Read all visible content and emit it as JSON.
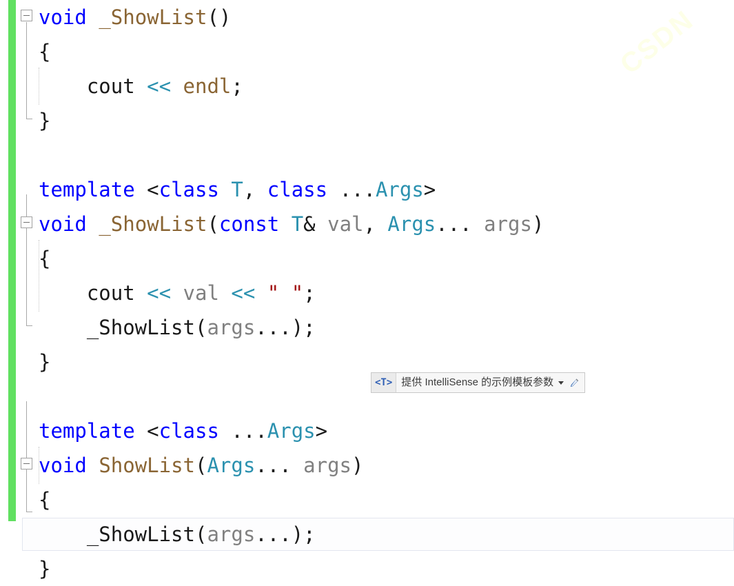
{
  "editor": {
    "language": "C++",
    "watermark_text": "CSDN",
    "change_bar_color": "#61e061",
    "current_line_index": 16
  },
  "colors": {
    "keyword": "#0000ff",
    "function": "#8a6534",
    "template_type": "#2b91af",
    "identifier": "#808080",
    "string": "#a31515",
    "punctuation": "#1a1a1a",
    "change_bar": "#61e061",
    "tooltip_badge_text": "#2f5fb5",
    "tooltip_background": "#f7f7f7"
  },
  "tooltip": {
    "badge": "<T>",
    "text": "提供 IntelliSense 的示例模板参数",
    "dropdown_icon": "chevron-down-icon",
    "edit_icon": "pencil-icon"
  },
  "code": {
    "lines": [
      {
        "n": 1,
        "collapse": true,
        "tokens": [
          {
            "t": "void",
            "c": "kw"
          },
          {
            "t": " ",
            "c": "plain"
          },
          {
            "t": "_ShowList",
            "c": "fn"
          },
          {
            "t": "()",
            "c": "punc"
          }
        ]
      },
      {
        "n": 2,
        "tokens": [
          {
            "t": "{",
            "c": "punc"
          }
        ]
      },
      {
        "n": 3,
        "indent": 4,
        "tokens": [
          {
            "t": "cout",
            "c": "plain"
          },
          {
            "t": " ",
            "c": "plain"
          },
          {
            "t": "<<",
            "c": "type"
          },
          {
            "t": " ",
            "c": "plain"
          },
          {
            "t": "endl",
            "c": "fn"
          },
          {
            "t": ";",
            "c": "punc"
          }
        ]
      },
      {
        "n": 4,
        "tokens": [
          {
            "t": "}",
            "c": "punc"
          }
        ]
      },
      {
        "n": 5,
        "tokens": []
      },
      {
        "n": 6,
        "tokens": [
          {
            "t": "template",
            "c": "kw"
          },
          {
            "t": " ",
            "c": "plain"
          },
          {
            "t": "<",
            "c": "punc"
          },
          {
            "t": "class",
            "c": "kw"
          },
          {
            "t": " ",
            "c": "plain"
          },
          {
            "t": "T",
            "c": "type"
          },
          {
            "t": ", ",
            "c": "punc"
          },
          {
            "t": "class",
            "c": "kw"
          },
          {
            "t": " ...",
            "c": "punc"
          },
          {
            "t": "Args",
            "c": "type"
          },
          {
            "t": ">",
            "c": "punc"
          }
        ]
      },
      {
        "n": 7,
        "collapse": true,
        "tokens": [
          {
            "t": "void",
            "c": "kw"
          },
          {
            "t": " ",
            "c": "plain"
          },
          {
            "t": "_ShowList",
            "c": "fn"
          },
          {
            "t": "(",
            "c": "punc"
          },
          {
            "t": "const",
            "c": "kw"
          },
          {
            "t": " ",
            "c": "plain"
          },
          {
            "t": "T",
            "c": "type"
          },
          {
            "t": "&",
            "c": "punc"
          },
          {
            "t": " ",
            "c": "plain"
          },
          {
            "t": "val",
            "c": "ident"
          },
          {
            "t": ", ",
            "c": "punc"
          },
          {
            "t": "Args",
            "c": "type"
          },
          {
            "t": "... ",
            "c": "punc"
          },
          {
            "t": "args",
            "c": "ident"
          },
          {
            "t": ")",
            "c": "punc"
          }
        ]
      },
      {
        "n": 8,
        "tokens": [
          {
            "t": "{",
            "c": "punc"
          }
        ]
      },
      {
        "n": 9,
        "indent": 4,
        "tokens": [
          {
            "t": "cout",
            "c": "plain"
          },
          {
            "t": " ",
            "c": "plain"
          },
          {
            "t": "<<",
            "c": "type"
          },
          {
            "t": " ",
            "c": "plain"
          },
          {
            "t": "val",
            "c": "ident"
          },
          {
            "t": " ",
            "c": "plain"
          },
          {
            "t": "<<",
            "c": "type"
          },
          {
            "t": " ",
            "c": "plain"
          },
          {
            "t": "\" \"",
            "c": "str"
          },
          {
            "t": ";",
            "c": "punc"
          }
        ]
      },
      {
        "n": 10,
        "indent": 4,
        "tokens": [
          {
            "t": "_ShowList",
            "c": "plain"
          },
          {
            "t": "(",
            "c": "punc"
          },
          {
            "t": "args",
            "c": "ident"
          },
          {
            "t": "...",
            "c": "punc"
          },
          {
            "t": ");",
            "c": "punc"
          }
        ]
      },
      {
        "n": 11,
        "tokens": [
          {
            "t": "}",
            "c": "punc"
          }
        ]
      },
      {
        "n": 12,
        "tokens": []
      },
      {
        "n": 13,
        "tokens": [
          {
            "t": "template",
            "c": "kw"
          },
          {
            "t": " ",
            "c": "plain"
          },
          {
            "t": "<",
            "c": "punc"
          },
          {
            "t": "class",
            "c": "kw"
          },
          {
            "t": " ...",
            "c": "punc"
          },
          {
            "t": "Args",
            "c": "type"
          },
          {
            "t": ">",
            "c": "punc"
          }
        ]
      },
      {
        "n": 14,
        "collapse": true,
        "tokens": [
          {
            "t": "void",
            "c": "kw"
          },
          {
            "t": " ",
            "c": "plain"
          },
          {
            "t": "ShowList",
            "c": "fn"
          },
          {
            "t": "(",
            "c": "punc"
          },
          {
            "t": "Args",
            "c": "type"
          },
          {
            "t": "... ",
            "c": "punc"
          },
          {
            "t": "args",
            "c": "ident"
          },
          {
            "t": ")",
            "c": "punc"
          }
        ]
      },
      {
        "n": 15,
        "tokens": [
          {
            "t": "{",
            "c": "punc"
          }
        ]
      },
      {
        "n": 16,
        "indent": 4,
        "current": true,
        "tokens": [
          {
            "t": "_ShowList",
            "c": "plain"
          },
          {
            "t": "(",
            "c": "punc"
          },
          {
            "t": "args",
            "c": "ident"
          },
          {
            "t": "...",
            "c": "punc"
          },
          {
            "t": ");",
            "c": "punc"
          }
        ]
      },
      {
        "n": 17,
        "tokens": [
          {
            "t": "}",
            "c": "punc"
          }
        ]
      }
    ]
  }
}
